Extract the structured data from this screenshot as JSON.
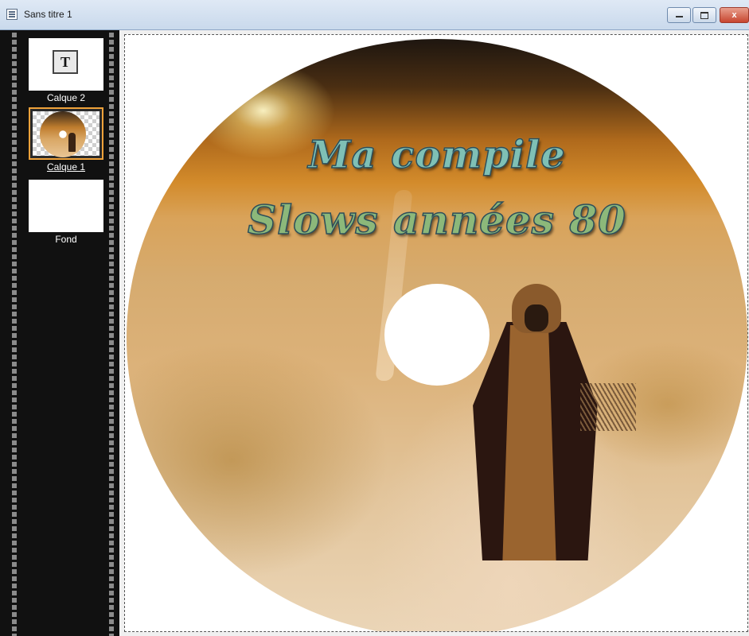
{
  "window": {
    "title": "Sans titre 1",
    "close_label": "x"
  },
  "layers": [
    {
      "label": "Calque 2",
      "type": "text",
      "icon_text": "T",
      "selected": false
    },
    {
      "label": "Calque 1",
      "type": "image",
      "selected": true
    },
    {
      "label": "Fond",
      "type": "background",
      "selected": false
    }
  ],
  "canvas": {
    "disc_text_line1": "Ma compile",
    "disc_text_line2": "Slows années 80"
  },
  "colors": {
    "selection_border": "#f0a23a",
    "panel_background": "#111111",
    "close_button": "#c7452f"
  }
}
